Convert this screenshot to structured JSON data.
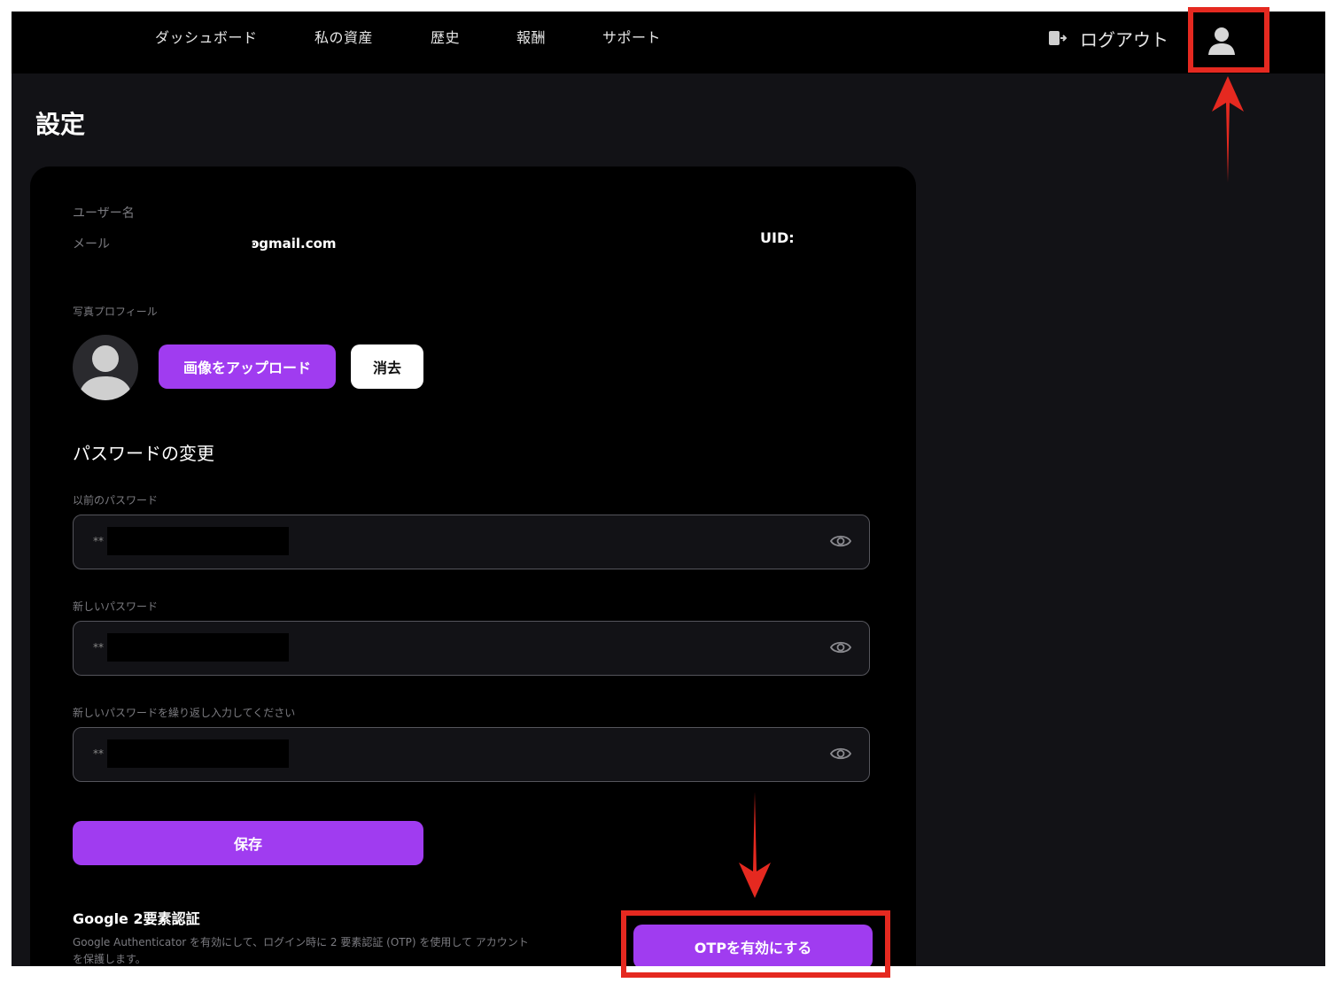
{
  "nav": {
    "items": [
      "ダッシュボード",
      "私の資産",
      "歴史",
      "報酬",
      "サポート"
    ],
    "logout_label": "ログアウト"
  },
  "page": {
    "title": "設定"
  },
  "account": {
    "username_label": "ユーザー名",
    "email_label": "メール",
    "email_value": "ͽgmail.com",
    "uid_label": "UID:"
  },
  "profile_photo": {
    "label": "写真プロフィール",
    "upload_button": "画像をアップロード",
    "delete_button": "消去"
  },
  "password": {
    "section_title": "パスワードの変更",
    "old_label": "以前のパスワード",
    "new_label": "新しいパスワード",
    "confirm_label": "新しいパスワードを繰り返し入力してください",
    "masked_value": "**",
    "save_button": "保存"
  },
  "otp": {
    "title": "Google 2要素認証",
    "description": "Google Authenticator を有効にして、ログイン時に 2 要素認証 (OTP) を使用して アカウントを保護します。",
    "enable_button": "OTPを有効にする"
  },
  "colors": {
    "accent": "#a03cf0",
    "annotation": "#e52920",
    "background": "#121216",
    "card": "#000000"
  }
}
